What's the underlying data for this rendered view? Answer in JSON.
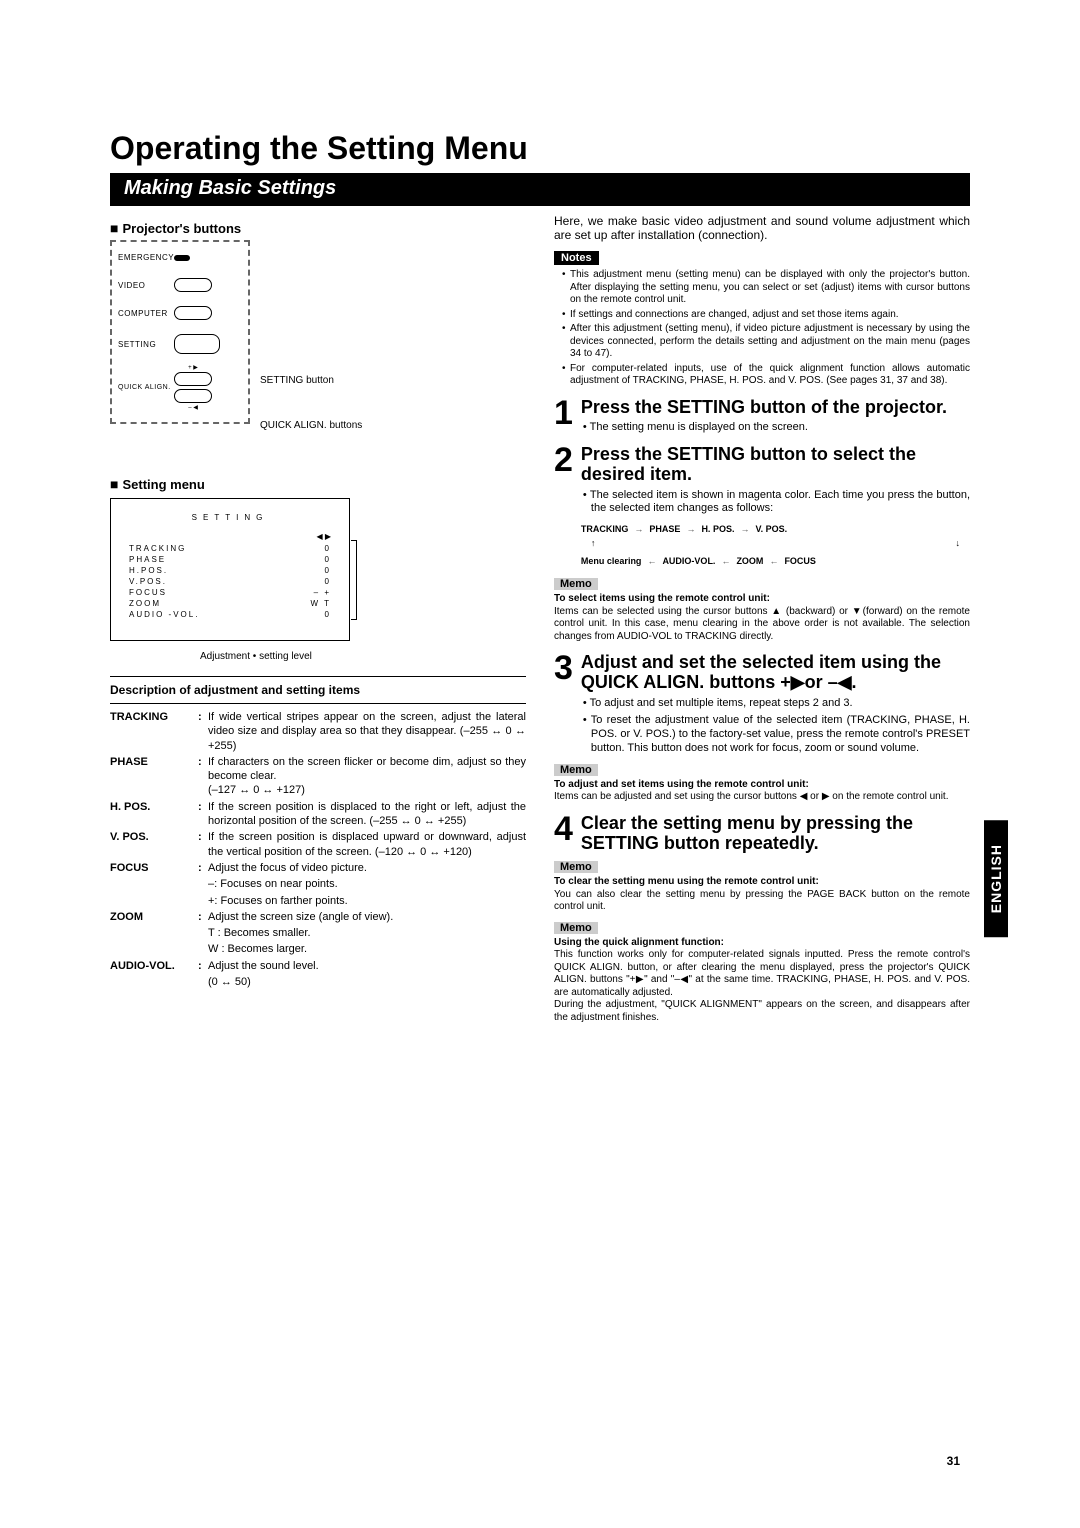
{
  "page_title": "Operating the Setting Menu",
  "section_bar": "Making Basic Settings",
  "language_tab": "ENGLISH",
  "page_number": "31",
  "left": {
    "projectors_buttons_heading": "Projector's buttons",
    "projector": {
      "emergency": "EMERGENCY",
      "video": "VIDEO",
      "computer": "COMPUTER",
      "setting": "SETTING",
      "quick_align": "QUICK ALIGN.",
      "plus": "+ ▶",
      "minus": "– ◀",
      "ann_setting": "SETTING button",
      "ann_qa": "QUICK ALIGN. buttons"
    },
    "setting_menu_heading": "Setting menu",
    "setting_panel": {
      "title": "SETTING",
      "arrows": "◀ ▶",
      "rows": [
        {
          "label": "TRACKING",
          "value": "0"
        },
        {
          "label": "PHASE",
          "value": "0"
        },
        {
          "label": "H.POS.",
          "value": "0"
        },
        {
          "label": "V.POS.",
          "value": "0"
        },
        {
          "label": "FOCUS",
          "value": "–    +"
        },
        {
          "label": "ZOOM",
          "value": "W    T"
        },
        {
          "label": "AUDIO -VOL.",
          "value": "0"
        }
      ]
    },
    "caption": "Adjustment • setting level",
    "desc_heading": "Description of adjustment and setting items",
    "descriptions": {
      "tracking_lbl": "TRACKING",
      "tracking": "If wide vertical stripes appear on the screen, adjust the lateral video size and display area so that they disappear. (–255 ↔ 0 ↔ +255)",
      "phase_lbl": "PHASE",
      "phase": "If characters on the screen flicker or become dim, adjust so they become clear.\n(–127 ↔ 0 ↔ +127)",
      "hpos_lbl": "H. POS.",
      "hpos": "If the screen position is displaced to the right or left, adjust the horizontal position of the screen. (–255 ↔ 0 ↔ +255)",
      "vpos_lbl": "V. POS.",
      "vpos": "If the screen position is displaced upward or downward, adjust the vertical position of the screen. (–120 ↔ 0 ↔ +120)",
      "focus_lbl": "FOCUS",
      "focus": "Adjust the focus of video picture.",
      "focus_a": "–: Focuses on near points.",
      "focus_b": "+: Focuses on farther points.",
      "zoom_lbl": "ZOOM",
      "zoom": "Adjust the screen size (angle of view).",
      "zoom_a": "T  : Becomes smaller.",
      "zoom_b": "W : Becomes larger.",
      "audio_lbl": "AUDIO-VOL.",
      "audio": "Adjust the sound level.",
      "audio_a": "(0 ↔ 50)"
    }
  },
  "right": {
    "intro": "Here, we make basic video adjustment and sound volume adjustment which are set up after installation (connection).",
    "notes_label": "Notes",
    "notes": [
      "This adjustment menu (setting menu) can be displayed with only the projector's button. After displaying the setting menu, you can select or set (adjust) items with cursor buttons on the remote control unit.",
      "If settings and connections are changed, adjust and set those items again.",
      "After this adjustment (setting menu), if video picture adjustment is necessary by using the devices connected, perform the details setting and adjustment on the main menu (pages 34 to 47).",
      "For computer-related inputs, use of the quick alignment function allows automatic adjustment of TRACKING, PHASE, H. POS. and V. POS. (See pages 31, 37 and 38)."
    ],
    "step1_num": "1",
    "step1_title": "Press the SETTING button of the projector.",
    "step1_b1": "• The setting menu is displayed on the screen.",
    "step2_num": "2",
    "step2_title": "Press the SETTING button to select the desired item.",
    "step2_b1": "• The selected item is shown in magenta color. Each time you press the button, the selected item changes as follows:",
    "flow_top": [
      "TRACKING",
      "PHASE",
      "H. POS.",
      "V. POS."
    ],
    "flow_bottom": [
      "Menu clearing",
      "AUDIO-VOL.",
      "ZOOM",
      "FOCUS"
    ],
    "memo_label": "Memo",
    "memo1_bold": "To select items using the remote control unit:",
    "memo1": "Items can be selected using the cursor buttons ▲ (backward) or ▼(forward) on the remote control unit. In this case, menu clearing in the above order is not available. The selection changes from AUDIO-VOL to TRACKING directly.",
    "step3_num": "3",
    "step3_title": "Adjust and set the selected item using the QUICK ALIGN. buttons +▶or –◀.",
    "step3_b1": "• To adjust and set multiple items, repeat steps 2 and 3.",
    "step3_b2": "• To reset the adjustment value of the selected item (TRACKING, PHASE, H. POS. or V. POS.) to the factory-set value, press the remote control's PRESET button. This button does not work for focus, zoom or sound volume.",
    "memo2_bold": "To adjust and set items using the remote control unit:",
    "memo2": "Items can be adjusted and set using the cursor buttons ◀ or ▶ on the remote control unit.",
    "step4_num": "4",
    "step4_title": "Clear the setting menu by pressing the SETTING button repeatedly.",
    "memo3_bold": "To clear the setting menu using the remote control unit:",
    "memo3": "You can also clear the setting menu by pressing the PAGE BACK button on the remote control unit.",
    "memo4_bold": "Using the quick alignment function:",
    "memo4": "This function works only for computer-related signals inputted. Press the remote control's QUICK ALIGN. button, or after clearing the menu displayed, press the projector's QUICK ALIGN. buttons \"+▶\" and \"–◀\" at the same time. TRACKING, PHASE, H. POS. and V. POS. are automatically adjusted.\nDuring the adjustment, \"QUICK ALIGNMENT\" appears on the screen, and disappears after the adjustment finishes."
  }
}
